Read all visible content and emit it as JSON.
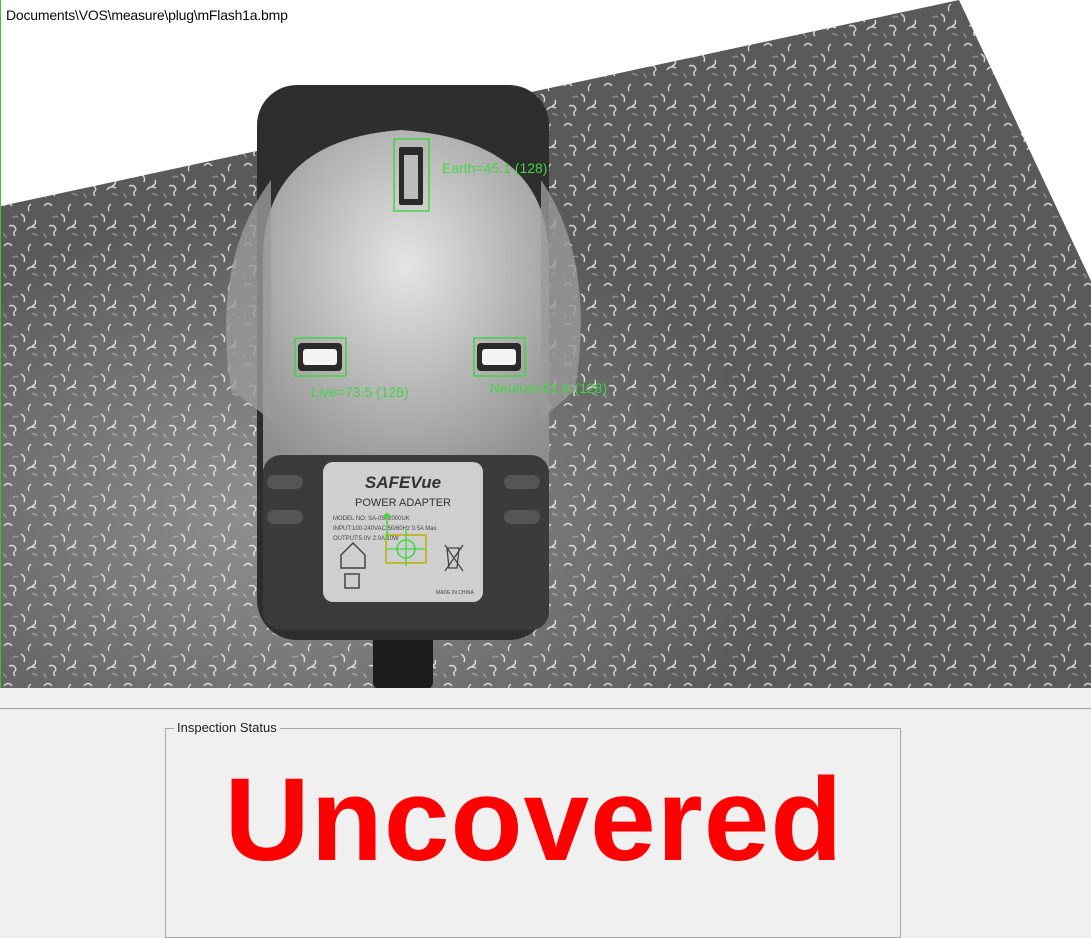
{
  "viewer": {
    "file_path": "Documents\\VOS\\measure\\plug\\mFlash1a.bmp",
    "overlays": [
      {
        "name": "Earth",
        "label": "Earth=45.1 (128)"
      },
      {
        "name": "Live",
        "label": "Live=73.5 (128)"
      },
      {
        "name": "Neutral",
        "label": "Neutral=51.6 (128)"
      }
    ],
    "overlay_color": "#44d444",
    "plug": {
      "brand": "SAFEVue",
      "title": "POWER ADAPTER",
      "model_text": "MODEL NO: SA-0502000UK",
      "input_text": "INPUT:100-240VAC 50/60Hz 0.5A Max",
      "output_text": "OUTPUT:5.0V 2.0A 10W",
      "made_in": "MADE IN CHINA"
    }
  },
  "inspection": {
    "group_title": "Inspection Status",
    "status": "Uncovered",
    "status_color": "#ff0000"
  }
}
